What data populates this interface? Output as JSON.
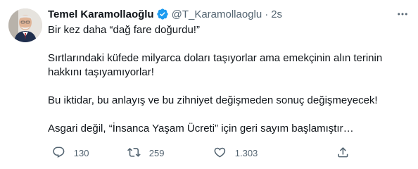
{
  "tweet": {
    "author": {
      "name": "Temel Karamollaoğlu",
      "handle": "@T_Karamollaoglu",
      "verified": true
    },
    "separator": "·",
    "time": "2s",
    "paragraphs": [
      "Bir kez daha “dağ fare doğurdu!”",
      "Sırtlarındaki küfede milyarca doları taşıyorlar ama emekçinin alın terinin hakkını taşıyamıyorlar!",
      "Bu iktidar, bu anlayış ve bu zihniyet değişmeden sonuç değişmeyecek!",
      "Asgari değil, “İnsanca Yaşam Ücreti” için geri sayım başlamıştır…"
    ],
    "actions": {
      "reply_count": "130",
      "retweet_count": "259",
      "like_count": "1.303"
    }
  },
  "icons": {
    "verified": "verified-badge-icon",
    "more": "more-options-icon",
    "reply": "reply-icon",
    "retweet": "retweet-icon",
    "like": "like-icon",
    "share": "share-icon"
  },
  "colors": {
    "text": "#0f1419",
    "secondary": "#536471",
    "verified": "#1d9bf0",
    "background": "#ffffff"
  }
}
